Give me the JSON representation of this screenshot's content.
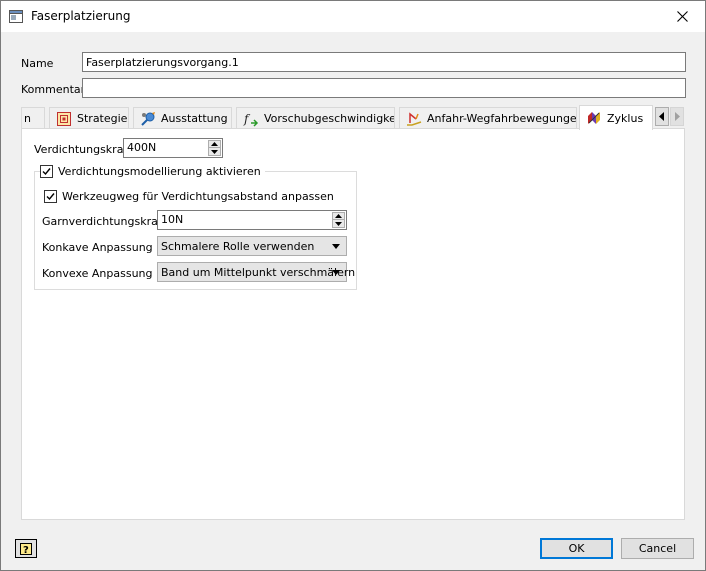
{
  "window": {
    "title": "Faserplatzierung"
  },
  "form": {
    "name_label": "Name",
    "name_value": "Faserplatzierungsvorgang.1",
    "comment_label": "Kommentar",
    "comment_value": ""
  },
  "tabs": [
    {
      "label": "n",
      "icon": "truncated-tab-icon"
    },
    {
      "label": "Strategie",
      "icon": "strategy-icon"
    },
    {
      "label": "Ausstattung",
      "icon": "equipment-icon"
    },
    {
      "label": "Vorschubgeschwindigkeit",
      "icon": "feedrate-icon"
    },
    {
      "label": "Anfahr-Wegfahrbewegungen",
      "icon": "approach-retract-icon"
    },
    {
      "label": "Zyklus",
      "icon": "cycle-icon",
      "active": true
    }
  ],
  "cycle": {
    "compaction_force_label": "Verdichtungskraft",
    "compaction_force_value": "400N",
    "modeling_checkbox_label": "Verdichtungsmodellierung aktivieren",
    "modeling_checked": true,
    "adjust_toolpath_label": "Werkzeugweg für Verdichtungsabstand anpassen",
    "adjust_toolpath_checked": true,
    "yarn_force_label": "Garnverdichtungskraft",
    "yarn_force_value": "10N",
    "concave_label": "Konkave Anpassung",
    "concave_value": "Schmalere Rolle verwenden",
    "convex_label": "Konvexe Anpassung",
    "convex_value": "Band um Mittelpunkt verschmälern"
  },
  "buttons": {
    "ok": "OK",
    "cancel": "Cancel"
  },
  "colors": {
    "accent": "#0078d7",
    "panel": "#ffffff",
    "chrome": "#f0f0f0"
  }
}
